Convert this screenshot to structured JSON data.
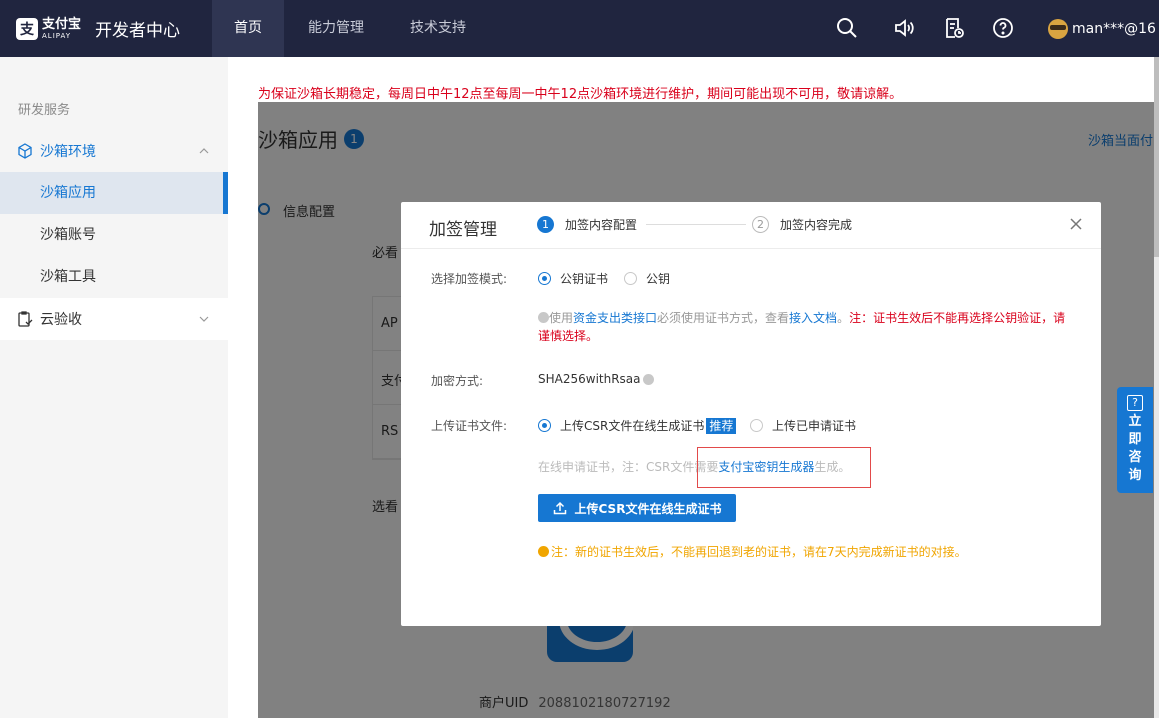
{
  "topnav": {
    "brand_cn": "支付宝",
    "brand_en": "ALIPAY",
    "title": "开发者中心",
    "items": [
      {
        "label": "首页",
        "active": true
      },
      {
        "label": "能力管理",
        "active": false
      },
      {
        "label": "技术支持",
        "active": false
      }
    ],
    "user": "man***@16",
    "icons": [
      "search-icon",
      "speaker-icon",
      "document-clock-icon",
      "help-icon"
    ]
  },
  "sidebar": {
    "section": "研发服务",
    "group1": "沙箱环境",
    "sub": [
      "沙箱应用",
      "沙箱账号",
      "沙箱工具"
    ],
    "group2": "云验收"
  },
  "main": {
    "notice": "为保证沙箱长期稳定，每周日中午12点至每周一中午12点沙箱环境进行维护，期间可能出现不可用，敬请谅解。",
    "title": "沙箱应用",
    "badge": "1",
    "right_link": "沙箱当面付",
    "info_label": "信息配置",
    "bg_must": "必看",
    "bg_rows": [
      "AP",
      "支付",
      "RS"
    ],
    "bg_select": "选看",
    "uid_label": "商户UID",
    "uid_value": "2088102180727192"
  },
  "consult": "立即咨询",
  "modal": {
    "title": "加签管理",
    "step1_num": "1",
    "step1": "加签内容配置",
    "step2_num": "2",
    "step2": "加签内容完成",
    "mode_label": "选择加签模式:",
    "mode_opt1": "公钥证书",
    "mode_opt2": "公钥",
    "tip_a": "使用",
    "tip_link1": "资金支出类接口",
    "tip_b": "必须使用证书方式，查看",
    "tip_link2": "接入文档",
    "tip_c": "。",
    "tip_warn": "注：证书生效后不能再选择公钥验证，请谨慎选择。",
    "algo_label": "加密方式:",
    "algo_value": "SHA256withRsaa",
    "upload_label": "上传证书文件:",
    "upload_opt1": "上传CSR文件在线生成证书",
    "upload_tag": "推荐",
    "upload_opt2": "上传已申请证书",
    "online_a": "在线申请证书，注：CSR文件需要",
    "online_link": "支付宝密钥生成器",
    "online_b": "生成。",
    "upload_button": "上传CSR文件在线生成证书",
    "warn": "注：新的证书生效后，不能再回退到老的证书，请在7天内完成新证书的对接。"
  }
}
